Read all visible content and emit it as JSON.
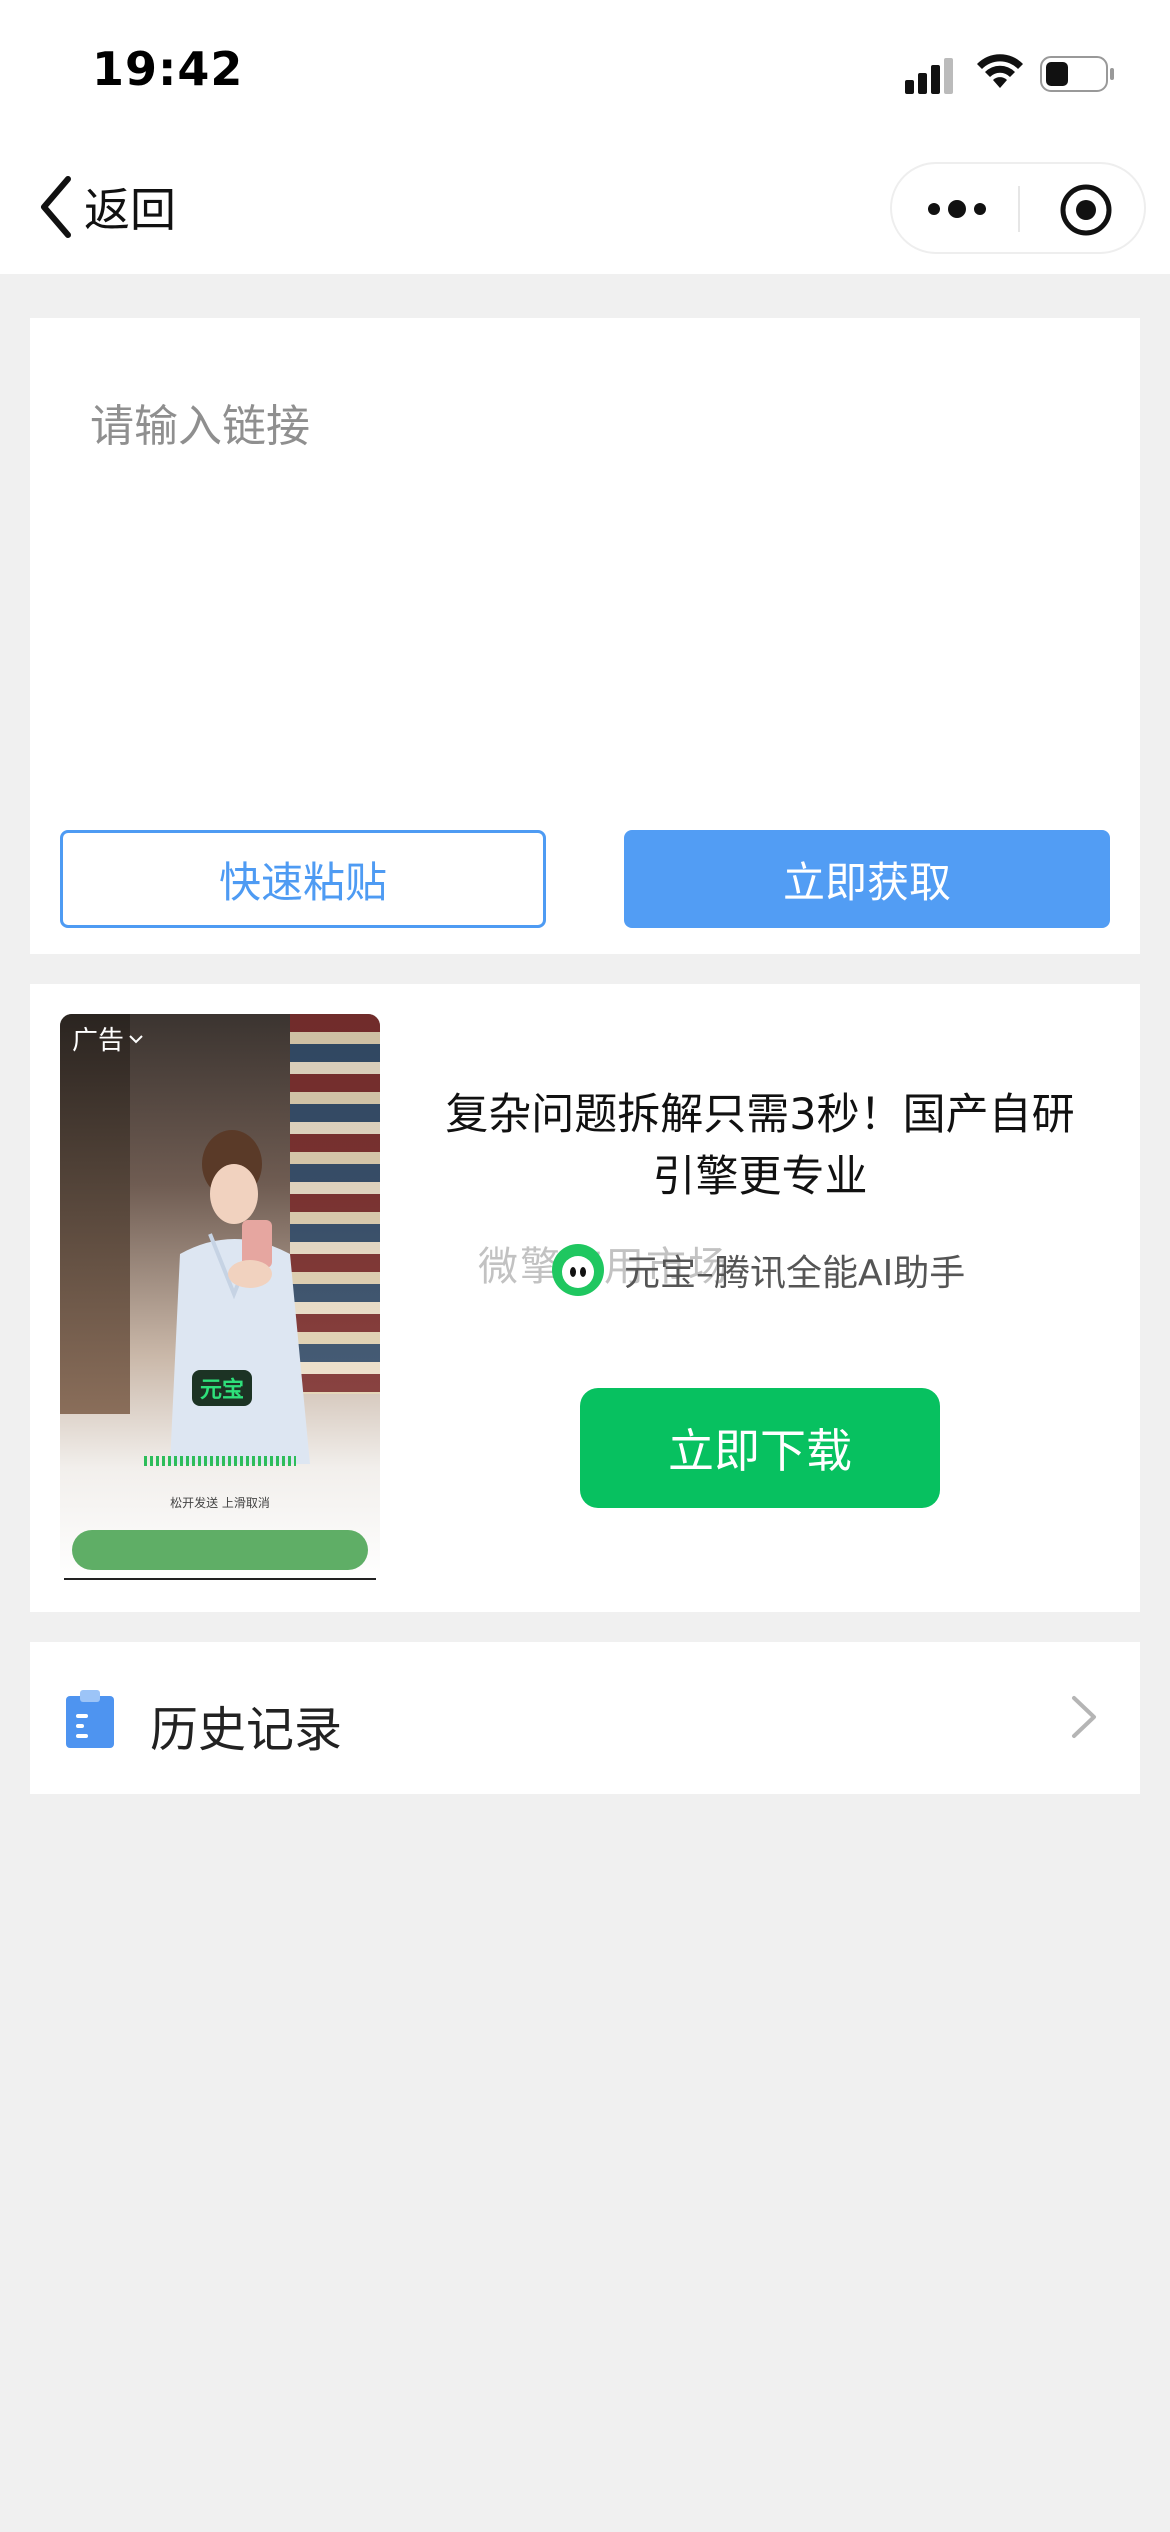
{
  "status_bar": {
    "time": "19:42"
  },
  "nav": {
    "back_label": "返回"
  },
  "input": {
    "placeholder": "请输入链接",
    "value": ""
  },
  "actions": {
    "paste_label": "快速粘贴",
    "get_label": "立即获取"
  },
  "ad": {
    "tag": "广告",
    "badge": "元宝",
    "voice_hint": "松开发送 上滑取消",
    "headline": "复杂问题拆解只需3秒！国产自研引擎更专业",
    "app_name": "元宝–腾讯全能AI助手",
    "watermark": "微擎应用市场",
    "download_label": "立即下载"
  },
  "history": {
    "label": "历史记录"
  },
  "colors": {
    "primary_blue": "#529df4",
    "wechat_green": "#07c160",
    "background": "#f0f0f0"
  },
  "icons": [
    "signal-icon",
    "wifi-icon",
    "battery-icon",
    "back-chevron-icon",
    "more-dots-icon",
    "close-target-icon",
    "yuanbao-app-icon",
    "clipboard-icon",
    "chevron-right-icon"
  ]
}
